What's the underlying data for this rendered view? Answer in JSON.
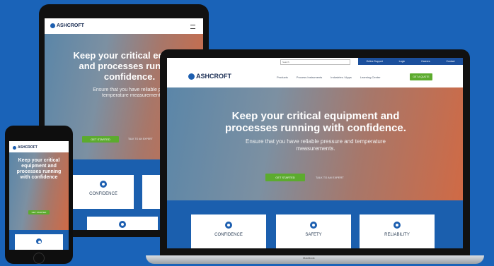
{
  "brand": "ASHCROFT",
  "hero": {
    "title_laptop_l1": "Keep your critical equipment and",
    "title_laptop_l2": "processes running with confidence.",
    "sub_laptop_l1": "Ensure that you have reliable pressure and temperature",
    "sub_laptop_l2": "measurements.",
    "title_tablet_l1": "Keep your critical equipm",
    "title_tablet_l2": "and processes running",
    "title_tablet_l3": "confidence.",
    "sub_tablet_l1": "Ensure that you have reliable pressu",
    "sub_tablet_l2": "temperature measurements.",
    "title_phone_l1": "Keep your critical",
    "title_phone_l2": "equipment and",
    "title_phone_l3": "processes running",
    "title_phone_l4": "with confidence",
    "cta": "GET STARTED",
    "secondary": "TALK TO AN EXPERT"
  },
  "utility_nav": [
    "Search",
    "Online Support",
    "Login",
    "Careers",
    "Contact"
  ],
  "main_nav": [
    "Products",
    "Process Instruments",
    "Industries / Apps",
    "Learning Center"
  ],
  "nav_cta": "GET A QUOTE",
  "cards": [
    {
      "title": "CONFIDENCE",
      "tablet_title": "CONFIDENCE"
    },
    {
      "title": "SAFETY"
    },
    {
      "title": "RELIABILITY"
    }
  ],
  "laptop_label": "MacBook"
}
